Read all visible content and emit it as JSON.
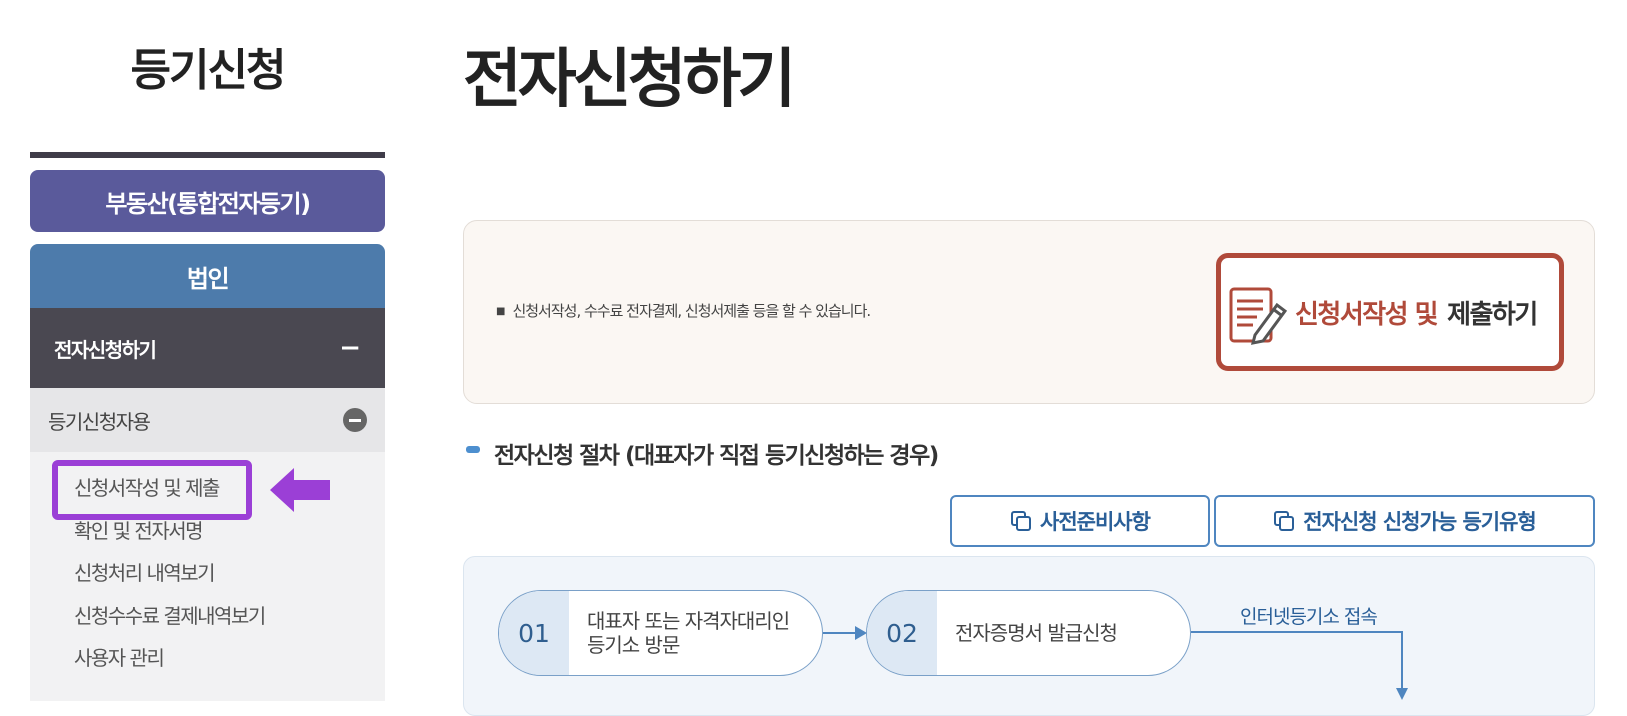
{
  "sidebar": {
    "title": "등기신청",
    "realestate_button": "부동산(통합전자등기)",
    "corporate_button": "법인",
    "active_menu": {
      "label": "전자신청하기",
      "toggle": "−"
    },
    "sub_menu": {
      "label": "등기신청자용"
    },
    "items": [
      {
        "label": "신청서작성 및 제출"
      },
      {
        "label": "확인 및 전자서명"
      },
      {
        "label": "신청처리 내역보기"
      },
      {
        "label": "신청수수료 결제내역보기"
      },
      {
        "label": "사용자 관리"
      }
    ]
  },
  "main": {
    "title": "전자신청하기",
    "info_text": "신청서작성, 수수료 전자결제, 신청서제출 등을 할 수 있습니다.",
    "submit_button": {
      "part1": "신청서작성 및",
      "part2": "제출하기"
    },
    "section_title": "전자신청 절차 (대표자가 직접 등기신청하는 경우)",
    "buttons": {
      "prep": "사전준비사항",
      "types": "전자신청 신청가능 등기유형"
    },
    "steps": [
      {
        "num": "01",
        "line1": "대표자 또는 자격자대리인",
        "line2": "등기소 방문"
      },
      {
        "num": "02",
        "line1": "전자증명서 발급신청",
        "line2": ""
      }
    ],
    "step_link_label": "인터넷등기소 접속"
  },
  "colors": {
    "highlight": "#9b3fd6",
    "realestate_bg": "#5a5a9b",
    "corporate_bg": "#4d7bab",
    "accent_red": "#b04a3a",
    "link_blue": "#2a5f98"
  }
}
